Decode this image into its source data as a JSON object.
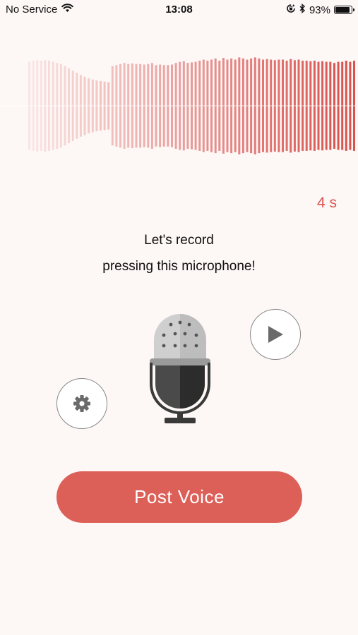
{
  "status_bar": {
    "carrier": "No Service",
    "time": "13:08",
    "battery_percent": "93%",
    "battery_level": 0.93,
    "icons": [
      "wifi-icon",
      "rotation-lock-icon",
      "bluetooth-icon",
      "battery-icon"
    ]
  },
  "waveform": {
    "color": "#d9534f",
    "levels": [
      0.8,
      0.82,
      0.83,
      0.82,
      0.83,
      0.82,
      0.8,
      0.78,
      0.76,
      0.72,
      0.68,
      0.64,
      0.6,
      0.56,
      0.53,
      0.5,
      0.48,
      0.46,
      0.45,
      0.44,
      0.43,
      0.72,
      0.74,
      0.76,
      0.78,
      0.76,
      0.77,
      0.76,
      0.76,
      0.75,
      0.76,
      0.78,
      0.74,
      0.75,
      0.74,
      0.74,
      0.75,
      0.78,
      0.8,
      0.81,
      0.78,
      0.79,
      0.8,
      0.82,
      0.84,
      0.82,
      0.84,
      0.86,
      0.82,
      0.87,
      0.84,
      0.86,
      0.84,
      0.88,
      0.86,
      0.84,
      0.86,
      0.88,
      0.86,
      0.84,
      0.85,
      0.84,
      0.83,
      0.84,
      0.84,
      0.82,
      0.85,
      0.83,
      0.84,
      0.82,
      0.82,
      0.81,
      0.82,
      0.8,
      0.81,
      0.8,
      0.8,
      0.78,
      0.8,
      0.8,
      0.82,
      0.8,
      0.82
    ]
  },
  "duration_label": "4 s",
  "instruction": {
    "line1": "Let's record",
    "line2": "pressing this microphone!"
  },
  "buttons": {
    "play_icon": "play-icon",
    "settings_icon": "gear-icon",
    "microphone_icon": "microphone-icon",
    "post_label": "Post Voice"
  },
  "colors": {
    "accent": "#dc5f58",
    "background": "#fdf7f6"
  }
}
